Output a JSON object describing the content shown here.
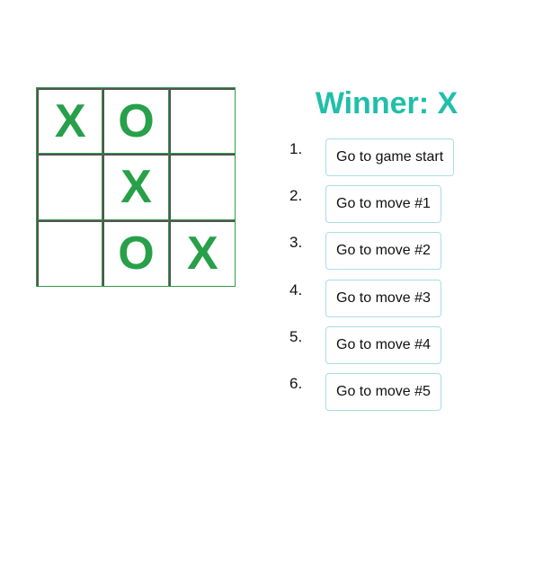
{
  "board": {
    "squares": [
      "X",
      "O",
      "",
      "",
      "X",
      "",
      "",
      "O",
      "X"
    ]
  },
  "status": {
    "text": "Winner: X"
  },
  "moves": [
    {
      "number": "1.",
      "label": "Go to game start"
    },
    {
      "number": "2.",
      "label": "Go to move #1"
    },
    {
      "number": "3.",
      "label": "Go to move #2"
    },
    {
      "number": "4.",
      "label": "Go to move #3"
    },
    {
      "number": "5.",
      "label": "Go to move #4"
    },
    {
      "number": "6.",
      "label": "Go to move #5"
    }
  ],
  "colors": {
    "board_border": "#2e9a48",
    "mark": "#28a04a",
    "status": "#1fbfa9",
    "button_border": "#a9dde6"
  }
}
